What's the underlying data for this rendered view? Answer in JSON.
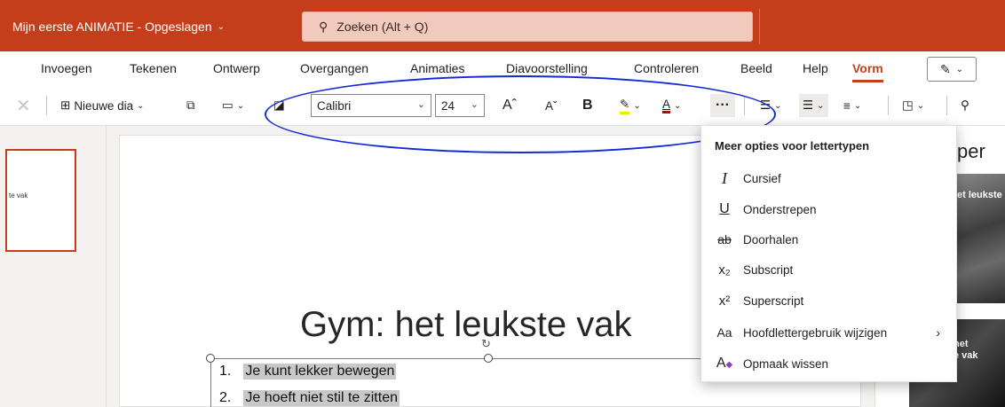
{
  "title_bar": {
    "document_title": "Mijn eerste ANIMATIE - Opgeslagen",
    "search_placeholder": "Zoeken (Alt + Q)",
    "accent_color": "#c43e1c"
  },
  "tabs": [
    {
      "label": "Invoegen"
    },
    {
      "label": "Tekenen"
    },
    {
      "label": "Ontwerp"
    },
    {
      "label": "Overgangen"
    },
    {
      "label": "Animaties"
    },
    {
      "label": "Diavoorstelling"
    },
    {
      "label": "Controleren"
    },
    {
      "label": "Beeld"
    },
    {
      "label": "Help"
    },
    {
      "label": "Vorm",
      "active": true
    }
  ],
  "toolbar": {
    "new_slide_label": "Nieuwe dia",
    "font_name": "Calibri",
    "font_size": "24",
    "bold_label": "B",
    "more_label": "···"
  },
  "font_menu": {
    "header": "Meer opties voor lettertypen",
    "items": [
      {
        "icon": "italic-icon",
        "glyph": "I",
        "label": "Cursief"
      },
      {
        "icon": "underline-icon",
        "glyph": "U",
        "label": "Onderstrepen"
      },
      {
        "icon": "strikethrough-icon",
        "glyph": "ab",
        "label": "Doorhalen"
      },
      {
        "icon": "subscript-icon",
        "glyph": "x₂",
        "label": "Subscript"
      },
      {
        "icon": "superscript-icon",
        "glyph": "x²",
        "label": "Superscript"
      },
      {
        "icon": "change-case-icon",
        "glyph": "Aa",
        "label": "Hoofdlettergebruik wijzigen",
        "submenu": true
      },
      {
        "icon": "clear-formatting-icon",
        "glyph": "A",
        "label": "Opmaak wissen"
      }
    ]
  },
  "thumbnail": {
    "text": "te vak"
  },
  "slide": {
    "title": "Gym: het leukste vak",
    "bullets": [
      {
        "num": "1.",
        "text": "Je kunt lekker bewegen"
      },
      {
        "num": "2.",
        "text": "Je hoeft niet stil te zitten"
      }
    ]
  },
  "designer_panel": {
    "title_fragment": "per",
    "card1_text": "et leukste",
    "card2_text": "het\ne vak"
  }
}
